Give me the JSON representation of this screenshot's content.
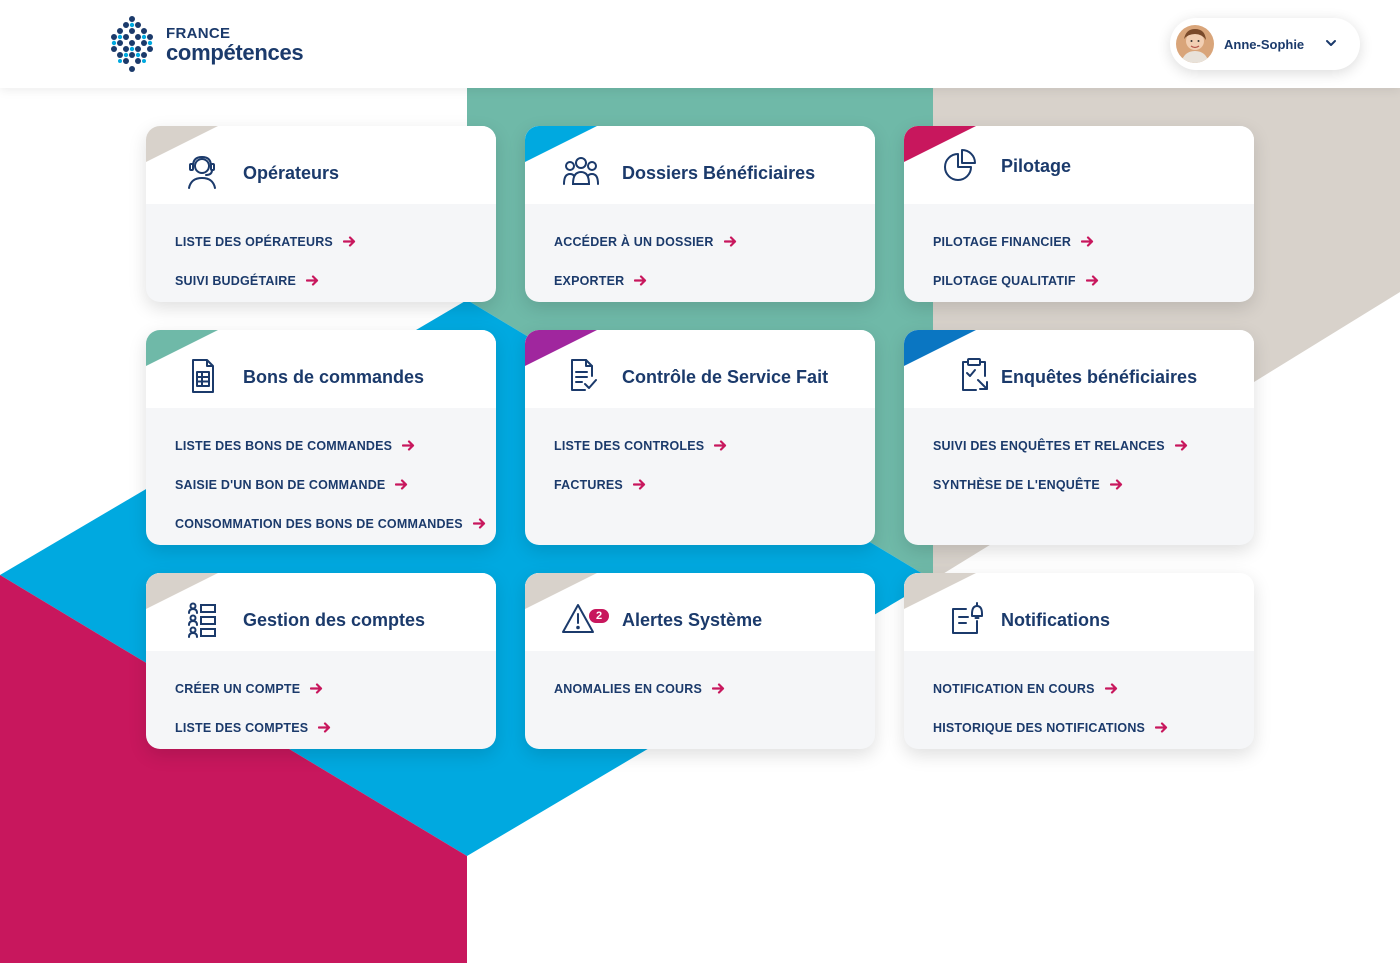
{
  "app": {
    "logo_line1": "FRANCE",
    "logo_line2": "compétences"
  },
  "user": {
    "name": "Anne-Sophie"
  },
  "colors": {
    "brand_dark": "#1b3a6b",
    "accent_pink": "#c8175d",
    "teal": "#6fb9a8",
    "sky": "#00a9e0",
    "beige": "#d8d2cb",
    "purple": "#a0269e",
    "blue": "#0a76c2"
  },
  "cards": [
    {
      "title": "Opérateurs",
      "icon": "operator-headset-icon",
      "corner_color": "#d8d2cb",
      "links": [
        "LISTE DES OPÉRATEURS",
        "SUIVI BUDGÉTAIRE"
      ]
    },
    {
      "title": "Dossiers Bénéficiaires",
      "icon": "people-group-icon",
      "corner_color": "#00a9e0",
      "links": [
        "ACCÉDER À UN DOSSIER",
        "EXPORTER"
      ]
    },
    {
      "title": "Pilotage",
      "icon": "pie-chart-icon",
      "corner_color": "#c8175d",
      "links": [
        "PILOTAGE FINANCIER",
        "PILOTAGE QUALITATIF"
      ]
    },
    {
      "title": "Bons de commandes",
      "icon": "order-document-icon",
      "corner_color": "#6fb9a8",
      "links": [
        "LISTE DES BONS DE COMMANDES",
        "SAISIE D'UN BON DE COMMANDE",
        "CONSOMMATION DES BONS DE COMMANDES"
      ]
    },
    {
      "title": "Contrôle de Service Fait",
      "icon": "document-check-icon",
      "corner_color": "#a0269e",
      "links": [
        "LISTE DES CONTROLES",
        "FACTURES"
      ]
    },
    {
      "title": "Enquêtes bénéficiaires",
      "icon": "clipboard-survey-icon",
      "corner_color": "#0a76c2",
      "links": [
        "SUIVI DES ENQUÊTES ET RELANCES",
        "SYNTHÈSE DE L'ENQUÊTE"
      ]
    },
    {
      "title": "Gestion des comptes",
      "icon": "accounts-list-icon",
      "corner_color": "#d8d2cb",
      "links": [
        "CRÉER UN COMPTE",
        "LISTE DES COMPTES"
      ]
    },
    {
      "title": "Alertes Système",
      "icon": "warning-triangle-icon",
      "corner_color": "#d8d2cb",
      "badge": "2",
      "links": [
        "ANOMALIES EN COURS"
      ]
    },
    {
      "title": "Notifications",
      "icon": "notification-bell-icon",
      "corner_color": "#d8d2cb",
      "links": [
        "NOTIFICATION EN COURS",
        "HISTORIQUE DES NOTIFICATIONS"
      ]
    }
  ]
}
